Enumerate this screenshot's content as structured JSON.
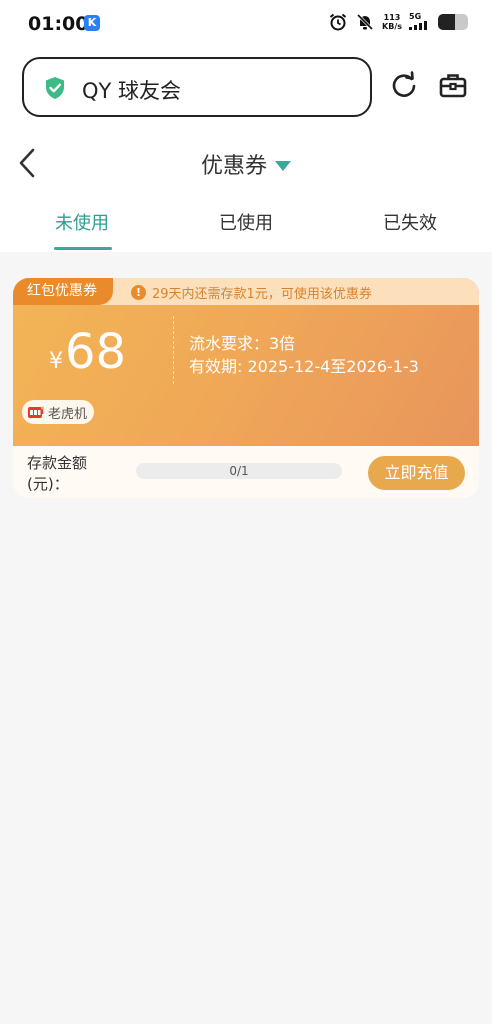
{
  "status_bar": {
    "time": "01:00",
    "notification_badge": "K",
    "net_speed": "113",
    "net_unit": "KB/s",
    "net_type": "5G",
    "battery_level": 0.55
  },
  "address_bar": {
    "site_name": "QY 球友会"
  },
  "header": {
    "title": "优惠券"
  },
  "tabs": [
    {
      "label": "未使用",
      "active": true
    },
    {
      "label": "已使用",
      "active": false
    },
    {
      "label": "已失效",
      "active": false
    }
  ],
  "coupon": {
    "tag": "红包优惠券",
    "notice": "29天内还需存款1元，可使用该优惠券",
    "currency": "¥",
    "amount": "68",
    "wagering": "流水要求：3倍",
    "validity": "有效期: 2025-12-4至2026-1-3",
    "game": "老虎机",
    "deposit_label": "存款金额(元)：",
    "progress_text": "0/1",
    "progress_value": 0,
    "button_label": "立即充值"
  },
  "colors": {
    "accent": "#3aa89d",
    "coupon_orange": "#f0a957",
    "tag_orange": "#e98b2b"
  }
}
